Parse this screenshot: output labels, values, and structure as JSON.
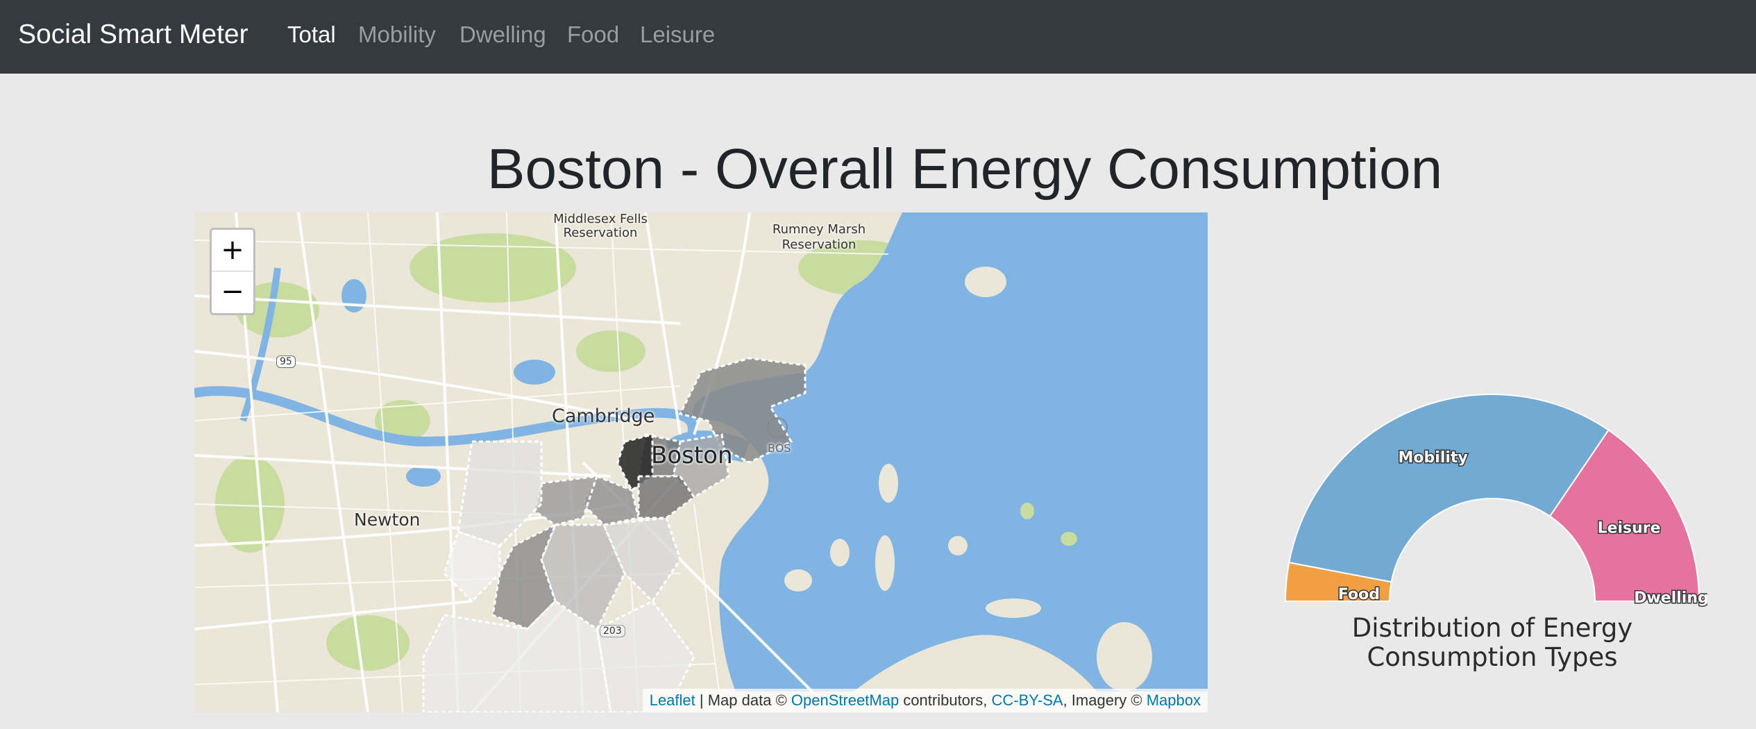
{
  "navbar": {
    "brand": "Social Smart Meter",
    "items": [
      {
        "label": "Total",
        "active": true
      },
      {
        "label": "Mobility",
        "active": false
      },
      {
        "label": "Dwelling",
        "active": false
      },
      {
        "label": "Food",
        "active": false
      },
      {
        "label": "Leisure",
        "active": false
      }
    ]
  },
  "page_title": "Boston - Overall Energy Consumption",
  "map": {
    "zoom_in": "+",
    "zoom_out": "−",
    "labels": {
      "cambridge": "Cambridge",
      "boston": "Boston",
      "newton": "Newton",
      "middlesex": "Middlesex Fells Reservation",
      "rumney": "Rumney Marsh Reservation",
      "bos": "BOS",
      "route95": "95",
      "route203": "203"
    },
    "attribution": {
      "leaflet": "Leaflet",
      "sep1": " | Map data © ",
      "osm": "OpenStreetMap",
      "sep2": " contributors, ",
      "license": "CC-BY-SA",
      "sep3": ", Imagery © ",
      "mapbox": "Mapbox"
    },
    "colors": {
      "water": "#80b4e2",
      "land": "#ece6d9",
      "park": "#c8dca0"
    }
  },
  "chart_data": {
    "type": "pie",
    "variant": "half-donut",
    "title": "Distribution of Energy Consumption Types",
    "slices": [
      {
        "label": "Food",
        "value": 6,
        "color": "#f0a042"
      },
      {
        "label": "Mobility",
        "value": 63,
        "color": "#73aad3"
      },
      {
        "label": "Leisure",
        "value": 31,
        "color": "#e672a0"
      },
      {
        "label": "Dwelling",
        "value": 0,
        "color": "#e0e0e0"
      }
    ]
  }
}
